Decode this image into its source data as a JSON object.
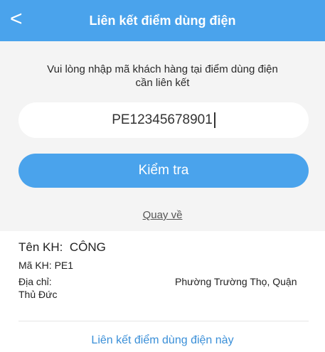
{
  "header": {
    "back_symbol": "<",
    "title": "Liên kết điểm dùng điện"
  },
  "form": {
    "instruction": "Vui lòng nhập mã khách hàng tại điểm dùng điện cần liên kết",
    "customer_code_value": "PE12345678901",
    "check_button_label": "Kiểm tra",
    "back_link_label": "Quay về"
  },
  "customer_info": {
    "name_label": "Tên KH:",
    "name_value": "CÔNG",
    "code_label": "Mã KH:",
    "code_value": "PE1",
    "address_label": "Địa chỉ:",
    "address_line1": "Phường Trường Thọ, Quận",
    "address_line2": "Thủ Đức"
  },
  "action": {
    "link_button_label": "Liên kết điểm dùng điện này"
  },
  "colors": {
    "primary": "#4aa3ec",
    "link": "#3a8fd8",
    "panel_background": "#f4f4f4"
  }
}
